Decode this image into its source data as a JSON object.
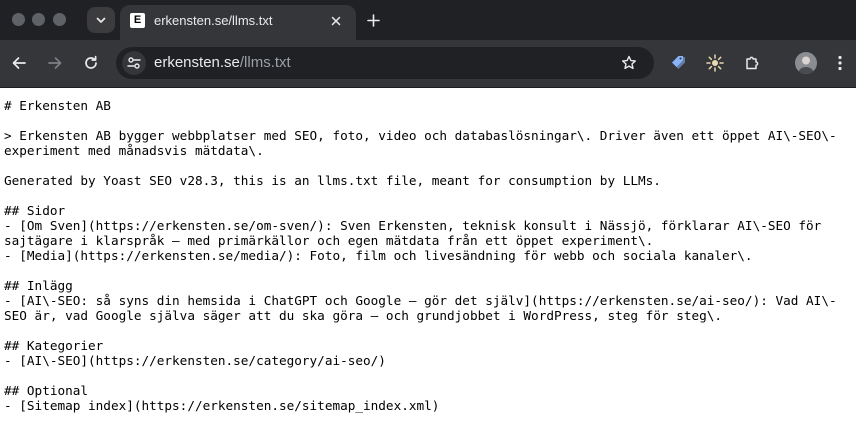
{
  "browser": {
    "tab": {
      "favicon_letter": "E",
      "title": "erkensten.se/llms.txt"
    },
    "address_bar": {
      "host": "erkensten.se",
      "path": "/llms.txt"
    },
    "icons": {
      "window_controls": [
        "close-light",
        "minimize-light",
        "zoom-light"
      ],
      "tab_search": "chevron-down-icon",
      "tab_close": "close-icon",
      "new_tab": "plus-icon",
      "back": "arrow-left-icon",
      "forward": "arrow-right-icon",
      "reload": "reload-icon",
      "site_info": "tune-icon",
      "bookmark": "star-icon",
      "extensions": [
        "tag-extension-icon",
        "sun-extension-icon",
        "puzzle-icon"
      ],
      "menu": "kebab-menu-icon"
    },
    "colors": {
      "frame": "#202124",
      "toolbar": "#35363a",
      "text_light": "#e8eaed",
      "text_dim": "#9aa0a6",
      "extension_blue": "#8ab4f8"
    }
  },
  "document": {
    "lines": [
      "# Erkensten AB",
      "",
      "> Erkensten AB bygger webbplatser med SEO, foto, video och databaslösningar\\. Driver även ett öppet AI\\-SEO\\-experiment med månadsvis mätdata\\.",
      "",
      "Generated by Yoast SEO v28.3, this is an llms.txt file, meant for consumption by LLMs.",
      "",
      "## Sidor",
      "- [Om Sven](https://erkensten.se/om-sven/): Sven Erkensten, teknisk konsult i Nässjö, förklarar AI\\-SEO för sajtägare i klarspråk – med primärkällor och egen mätdata från ett öppet experiment\\.",
      "- [Media](https://erkensten.se/media/): Foto, film och livesändning för webb och sociala kanaler\\.",
      "",
      "## Inlägg",
      "- [AI\\-SEO: så syns din hemsida i ChatGPT och Google – gör det själv](https://erkensten.se/ai-seo/): Vad AI\\-SEO är, vad Google själva säger att du ska göra – och grundjobbet i WordPress, steg för steg\\.",
      "",
      "## Kategorier",
      "- [AI\\-SEO](https://erkensten.se/category/ai-seo/)",
      "",
      "## Optional",
      "- [Sitemap index](https://erkensten.se/sitemap_index.xml)"
    ]
  }
}
